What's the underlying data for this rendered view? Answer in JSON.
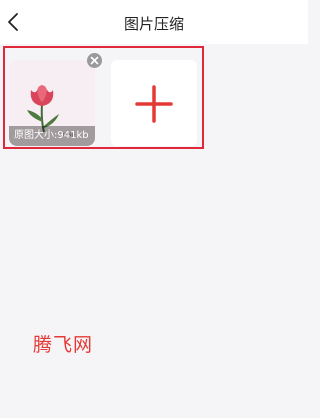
{
  "header": {
    "title": "图片压缩",
    "back_icon": "chevron-left-icon"
  },
  "images": [
    {
      "size_label": "原图大小:941kb",
      "thumbnail_icon": "tulip-illustration",
      "remove_icon": "close-icon"
    }
  ],
  "add_tile": {
    "icon": "plus-icon"
  },
  "watermark": "腾飞网",
  "colors": {
    "accent": "#e0283a",
    "plus": "#e53935",
    "background": "#f5f5f7"
  }
}
